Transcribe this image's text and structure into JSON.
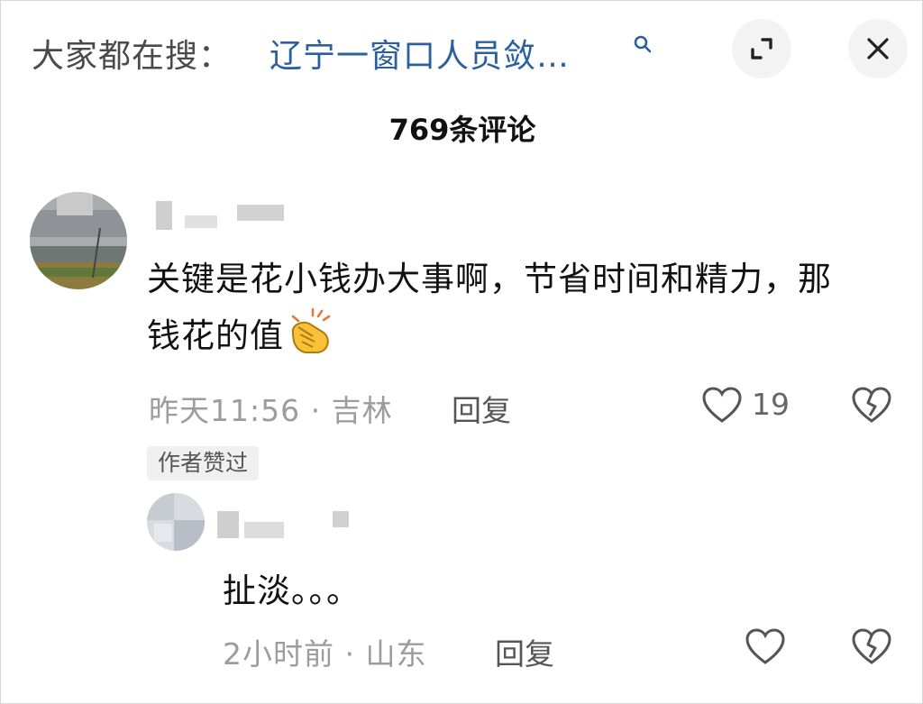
{
  "search": {
    "prefix": "大家都在搜：",
    "query": "辽宁一窗口人员敛…"
  },
  "header": {
    "title": "769条评论"
  },
  "comments": [
    {
      "text": "关键是花小钱办大事啊，节省时间和精力，那钱花的值",
      "emoji": "clapping-hands",
      "time": "昨天11:56",
      "separator": "·",
      "location": "吉林",
      "reply_label": "回复",
      "likes": "19",
      "badge": "作者赞过"
    },
    {
      "text": "扯淡。。。",
      "time": "2小时前",
      "separator": "·",
      "location": "山东",
      "reply_label": "回复"
    }
  ],
  "colors": {
    "query_link": "#2b5f9e",
    "meta_gray": "#9c9c9c",
    "clap_yellow": "#f7c238"
  }
}
